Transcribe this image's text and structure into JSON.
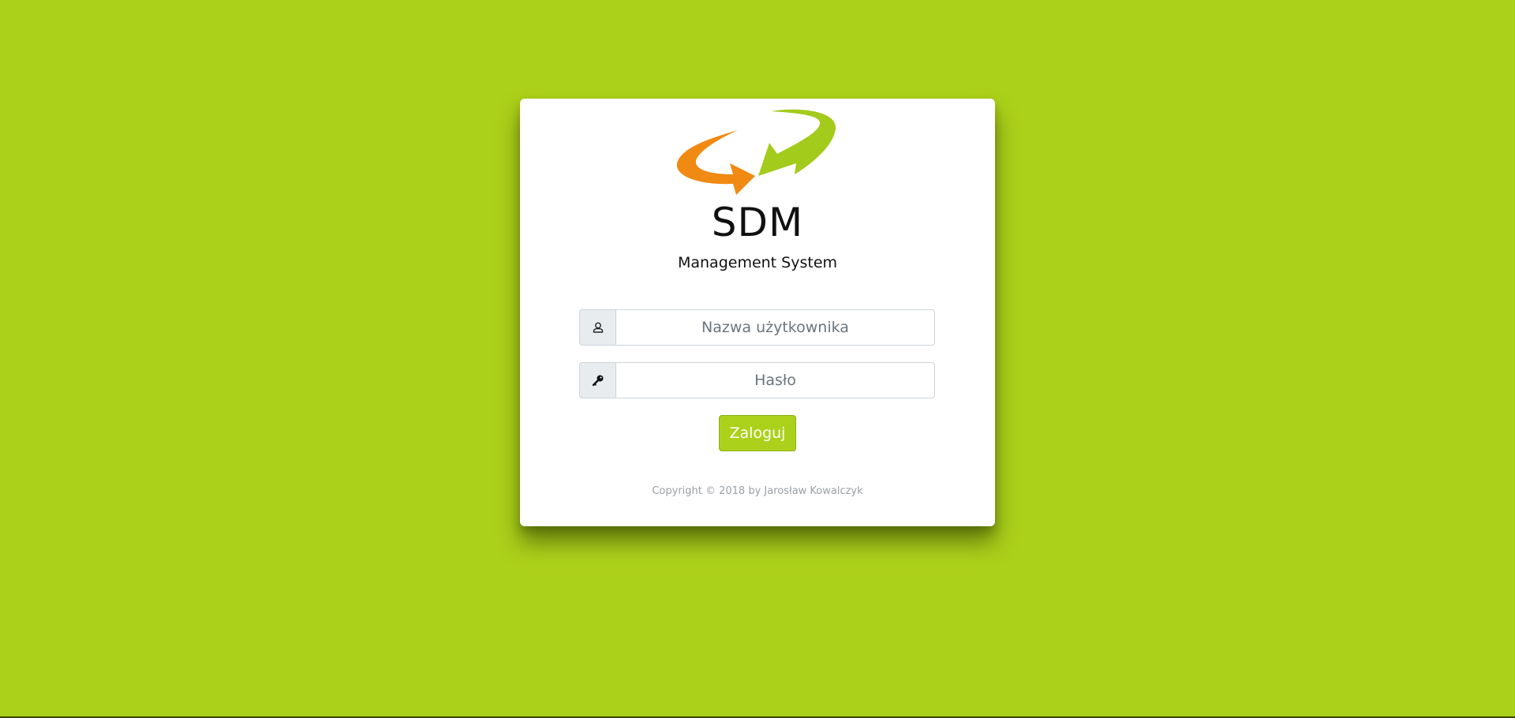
{
  "app": {
    "title": "SDM",
    "subtitle": "Management System"
  },
  "login_form": {
    "username_placeholder": "Nazwa użytkownika",
    "username_value": "",
    "username_icon": "user-icon",
    "password_placeholder": "Hasło",
    "password_value": "",
    "password_icon": "key-icon",
    "submit_label": "Zaloguj"
  },
  "footer": {
    "copyright": "Copyright © 2018 by Jarosław Kowalczyk"
  },
  "colors": {
    "background": "#acd11a",
    "accent": "#acd11a",
    "logo_orange": "#f08a12",
    "logo_green": "#a3cb1c",
    "card": "#ffffff"
  }
}
